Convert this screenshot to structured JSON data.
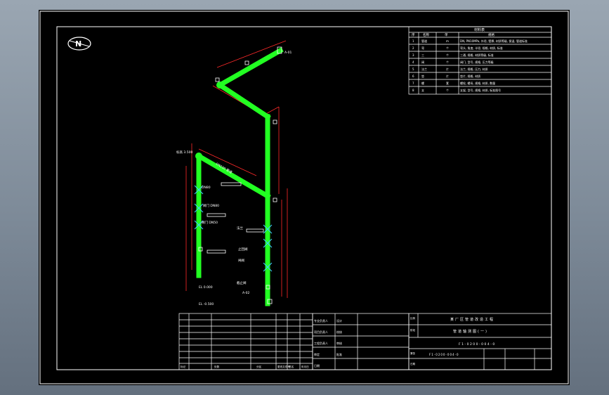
{
  "north_label": "N",
  "legend": {
    "title": "材料表",
    "headers": [
      "序",
      "名称",
      "单",
      "规格"
    ],
    "rows": [
      [
        "1",
        "管道",
        "m",
        "DN, PN10MPa, 外径, 壁厚, 材质等级, 保温, 管道标准"
      ],
      [
        "2",
        "弯",
        "个",
        "弯头, 角度, 半径, 规格, 材质, 标准"
      ],
      [
        "3",
        "三",
        "个",
        "三通, 规格, 材质等级, 标准"
      ],
      [
        "4",
        "阀",
        "个",
        "阀门, 型号, 规格, 压力等级"
      ],
      [
        "5",
        "法兰",
        "片",
        "法兰, 规格, 压力, 材质"
      ],
      [
        "6",
        "垫",
        "片",
        "垫片, 规格, 材质"
      ],
      [
        "7",
        "螺",
        "套",
        "螺栓, 螺母, 规格, 材质, 数量"
      ],
      [
        "8",
        "支",
        "个",
        "支架, 型号, 规格, 材质, 标准图号"
      ]
    ]
  },
  "title_block": {
    "project": "某厂区管道改造工程",
    "drawing_name": "管道轴测图(一)",
    "drawing_number": "F1-0200-004-0",
    "drawing_number_short": "F1-0200-004-0",
    "labels_left": [
      "设计",
      "校核",
      "审核",
      "批准"
    ],
    "labels_mid": [
      "专业负责人",
      "项目负责人",
      "工程负责人",
      "审定",
      "日期"
    ],
    "label_scale": "比例",
    "label_sheet": "第张",
    "label_stage": "阶段",
    "label_date": "日期",
    "bottom_labels": [
      "标记",
      "处数",
      "分区",
      "更改文件号",
      "签名",
      "年月日"
    ]
  },
  "annotations": [
    "标高 3.500",
    "DN100 管道",
    "DN80",
    "阀门 DN80",
    "阀门 DN50",
    "法兰",
    "止回阀",
    "闸阀",
    "截止阀",
    "EL 0.000",
    "EL -0.500",
    "A-01",
    "A-02"
  ],
  "colors": {
    "pipe": "#22ff22",
    "dimension": "#ff2a2a",
    "valve": "#3fd0ff",
    "text": "#ffffff",
    "sheet_bg": "#000000"
  }
}
